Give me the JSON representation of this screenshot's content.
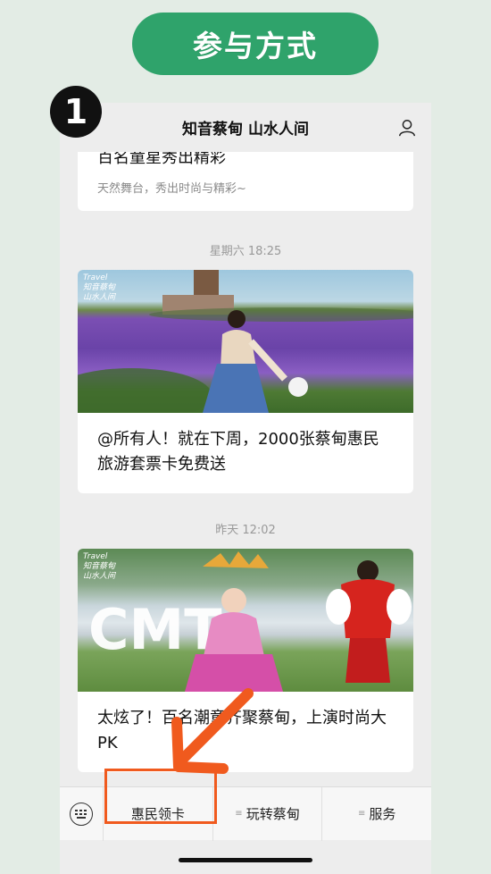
{
  "banner": {
    "label": "参与方式"
  },
  "step": {
    "number": "1"
  },
  "titlebar": {
    "title": "知音蔡甸 山水人间",
    "user_icon": "user-icon"
  },
  "feed": {
    "prev_card": {
      "title": "百名童星秀出精彩",
      "subtitle": "天然舞台，秀出时尚与精彩~"
    },
    "items": [
      {
        "timestamp": "星期六 18:25",
        "text": "@所有人！就在下周，2000张蔡甸惠民旅游套票卡免费送",
        "image_logo": "Travel 知音蔡甸 山水人间"
      },
      {
        "timestamp": "昨天 12:02",
        "text": "太炫了！百名潮童齐聚蔡甸，上演时尚大PK",
        "image_logo": "Travel 知音蔡甸 山水人间"
      }
    ]
  },
  "menu": {
    "keyboard_icon": "keyboard-icon",
    "items": [
      {
        "label": "惠民领卡"
      },
      {
        "label": "玩转蔡甸"
      },
      {
        "label": "服务"
      }
    ]
  },
  "colors": {
    "banner": "#2fa36b",
    "highlight": "#f05a1e",
    "background": "#e3ece5"
  }
}
